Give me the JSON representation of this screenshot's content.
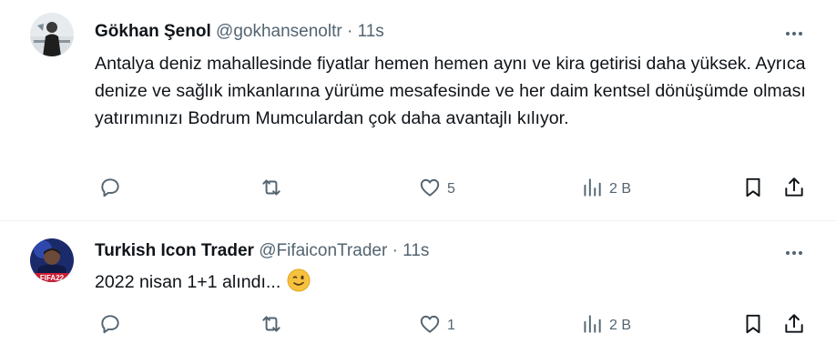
{
  "tweets": [
    {
      "author_name": "Gökhan Şenol",
      "handle": "@gokhansenoltr",
      "separator": "·",
      "time": "11s",
      "text": "Antalya deniz mahallesinde fiyatlar hemen hemen aynı ve kira getirisi daha yüksek. Ayrıca denize ve sağlık imkanlarına yürüme mesafesinde ve her daim kentsel dönüşümde olması yatırımınızı Bodrum Mumculardan çok daha avantajlı kılıyor.",
      "likes": "5",
      "views": "2 B"
    },
    {
      "author_name": "Turkish Icon Trader",
      "handle": "@FifaiconTrader",
      "separator": "·",
      "time": "11s",
      "text": "2022 nisan 1+1 alındı...",
      "likes": "1",
      "views": "2 B",
      "avatar_badge": "FIFA22"
    }
  ],
  "icons": [
    "reply-icon",
    "retweet-icon",
    "like-icon",
    "views-icon",
    "bookmark-icon",
    "share-icon",
    "more-icon",
    "winking-face-emoji"
  ],
  "colors": {
    "text": "#0f1419",
    "secondary": "#536471",
    "divider": "#eff3f4"
  }
}
